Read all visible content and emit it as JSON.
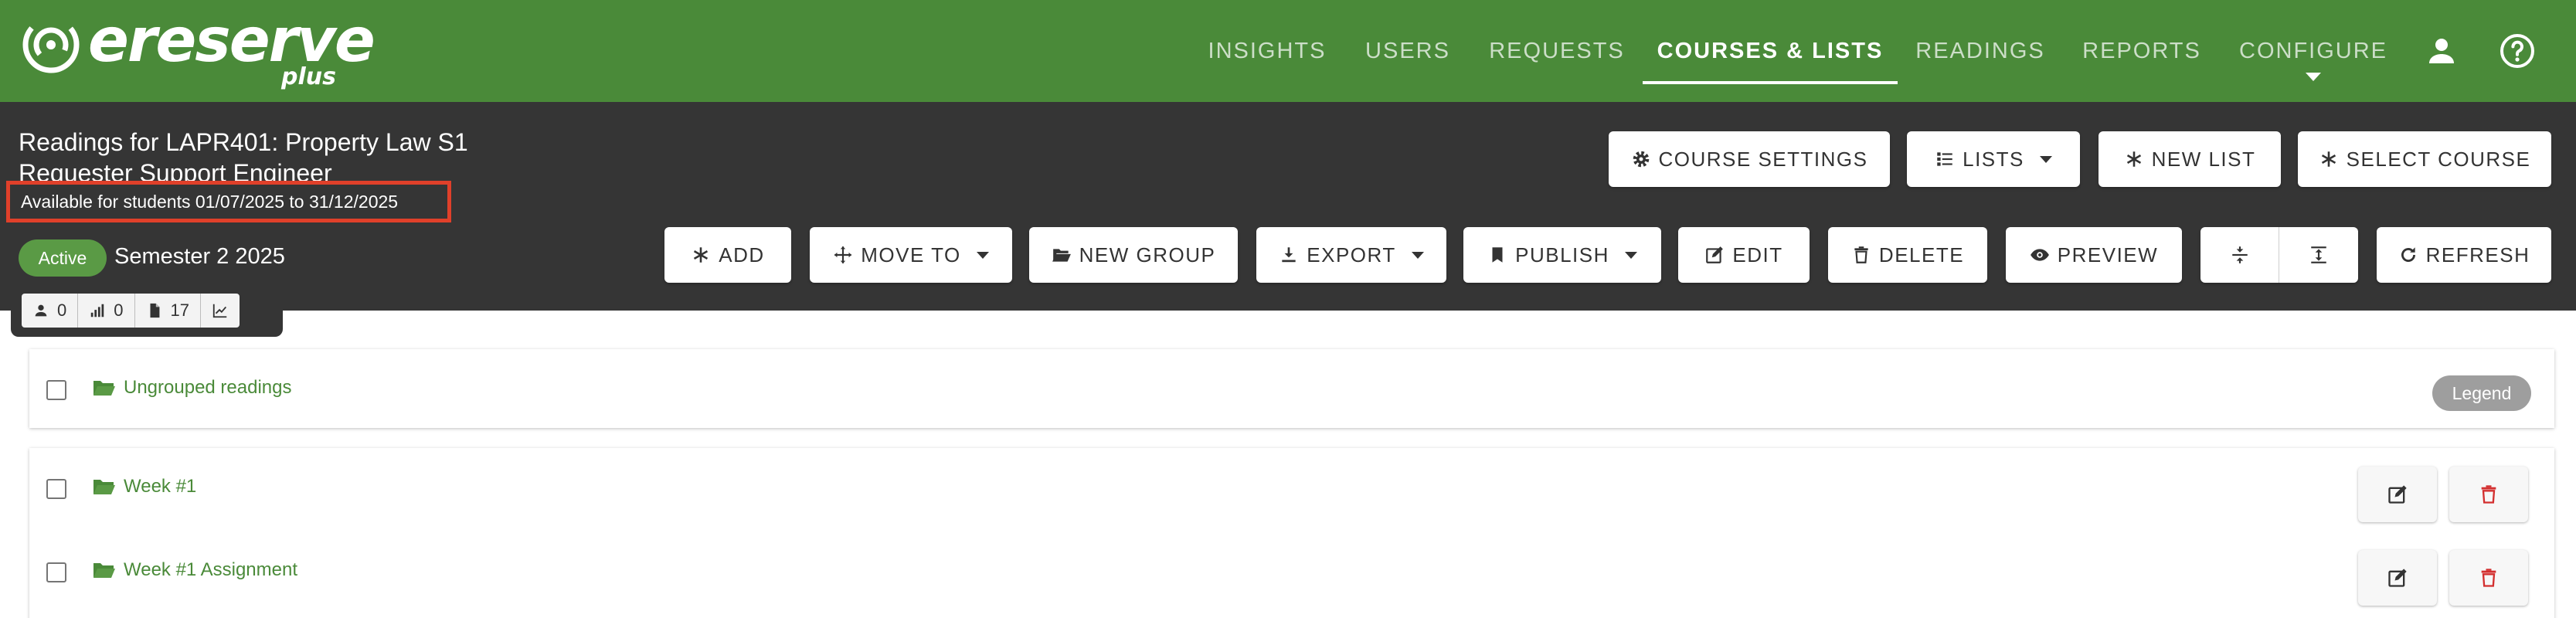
{
  "brand": {
    "name": "ereserve",
    "sub": "plus"
  },
  "nav": {
    "items": [
      {
        "label": "INSIGHTS"
      },
      {
        "label": "USERS"
      },
      {
        "label": "REQUESTS"
      },
      {
        "label": "COURSES & LISTS"
      },
      {
        "label": "READINGS"
      },
      {
        "label": "REPORTS"
      },
      {
        "label": "CONFIGURE"
      }
    ],
    "active": "COURSES & LISTS"
  },
  "header": {
    "title": "Readings for LAPR401: Property Law S1",
    "subtitle": "Requester Support Engineer",
    "availability": "Available for students 01/07/2025 to 31/12/2025",
    "status": "Active",
    "semester": "Semester 2 2025",
    "stats": {
      "students": "0",
      "activity": "0",
      "readings": "17"
    }
  },
  "toolbar_top": {
    "course_settings": "COURSE SETTINGS",
    "lists": "LISTS",
    "new_list": "NEW LIST",
    "select_course": "SELECT COURSE"
  },
  "toolbar_main": {
    "add": "ADD",
    "move_to": "MOVE TO",
    "new_group": "NEW GROUP",
    "export": "EXPORT",
    "publish": "PUBLISH",
    "edit": "EDIT",
    "delete": "DELETE",
    "preview": "PREVIEW",
    "refresh": "REFRESH"
  },
  "groups": {
    "ungrouped": "Ungrouped readings",
    "legend": "Legend",
    "items": [
      {
        "label": "Week #1"
      },
      {
        "label": "Week #1 Assignment"
      }
    ]
  },
  "colors": {
    "brand_green": "#4a8a39",
    "header_dark": "#353535",
    "highlight": "#e0402a",
    "delete_red": "#d32f2f"
  }
}
